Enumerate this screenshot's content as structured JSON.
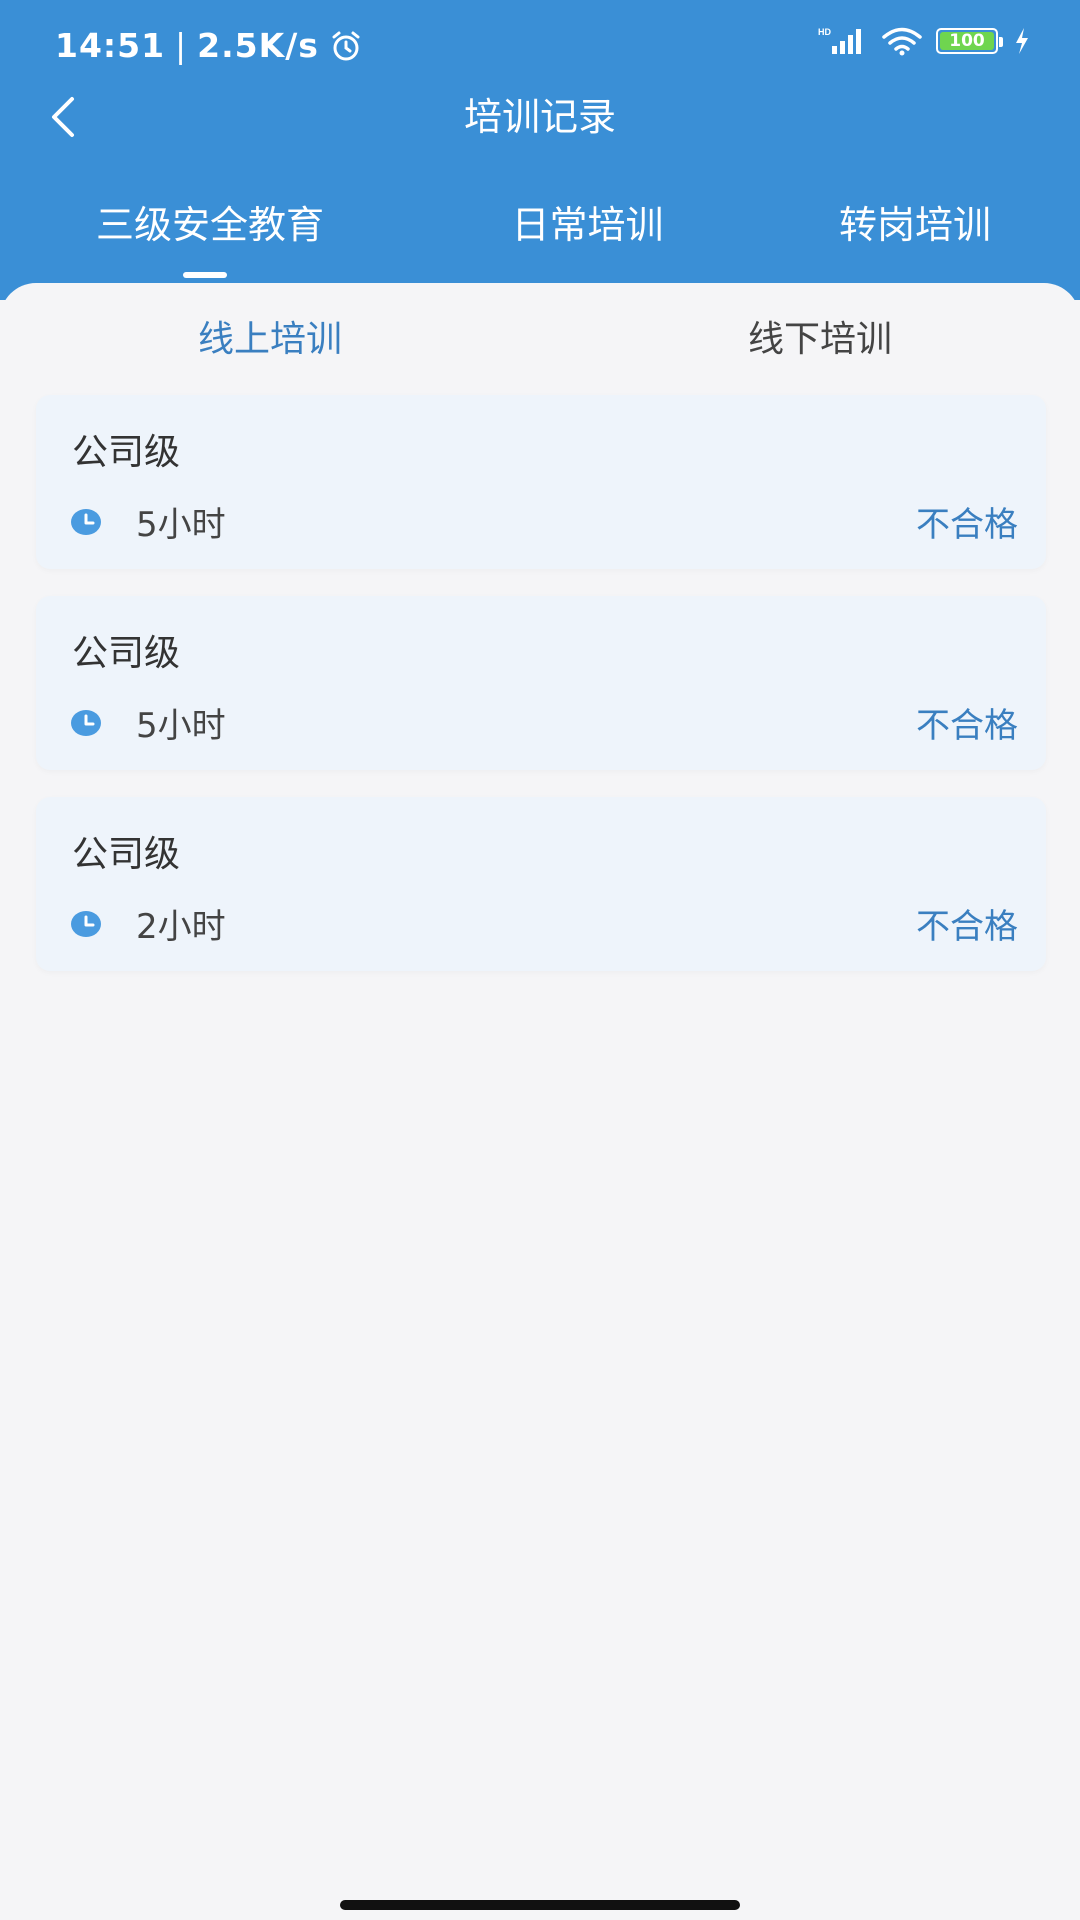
{
  "status_bar": {
    "time": "14:51",
    "speed": "2.5K/s",
    "battery": "100",
    "icons": [
      "alarm-icon",
      "signal-icon",
      "wifi-icon",
      "battery-icon",
      "charging-icon"
    ]
  },
  "nav": {
    "title": "培训记录",
    "back_icon": "chevron-left-icon"
  },
  "top_tabs": [
    {
      "label": "三级安全教育",
      "active": true
    },
    {
      "label": "日常培训",
      "active": false
    },
    {
      "label": "转岗培训",
      "active": false
    }
  ],
  "sub_tabs": [
    {
      "label": "线上培训",
      "active": true
    },
    {
      "label": "线下培训",
      "active": false
    }
  ],
  "records": [
    {
      "title": "公司级",
      "duration": "5小时",
      "status": "不合格"
    },
    {
      "title": "公司级",
      "duration": "5小时",
      "status": "不合格"
    },
    {
      "title": "公司级",
      "duration": "2小时",
      "status": "不合格"
    }
  ],
  "colors": {
    "header": "#3a8fd6",
    "accent": "#3a7fc0",
    "card": "#eef4fb",
    "background": "#f5f5f7"
  }
}
